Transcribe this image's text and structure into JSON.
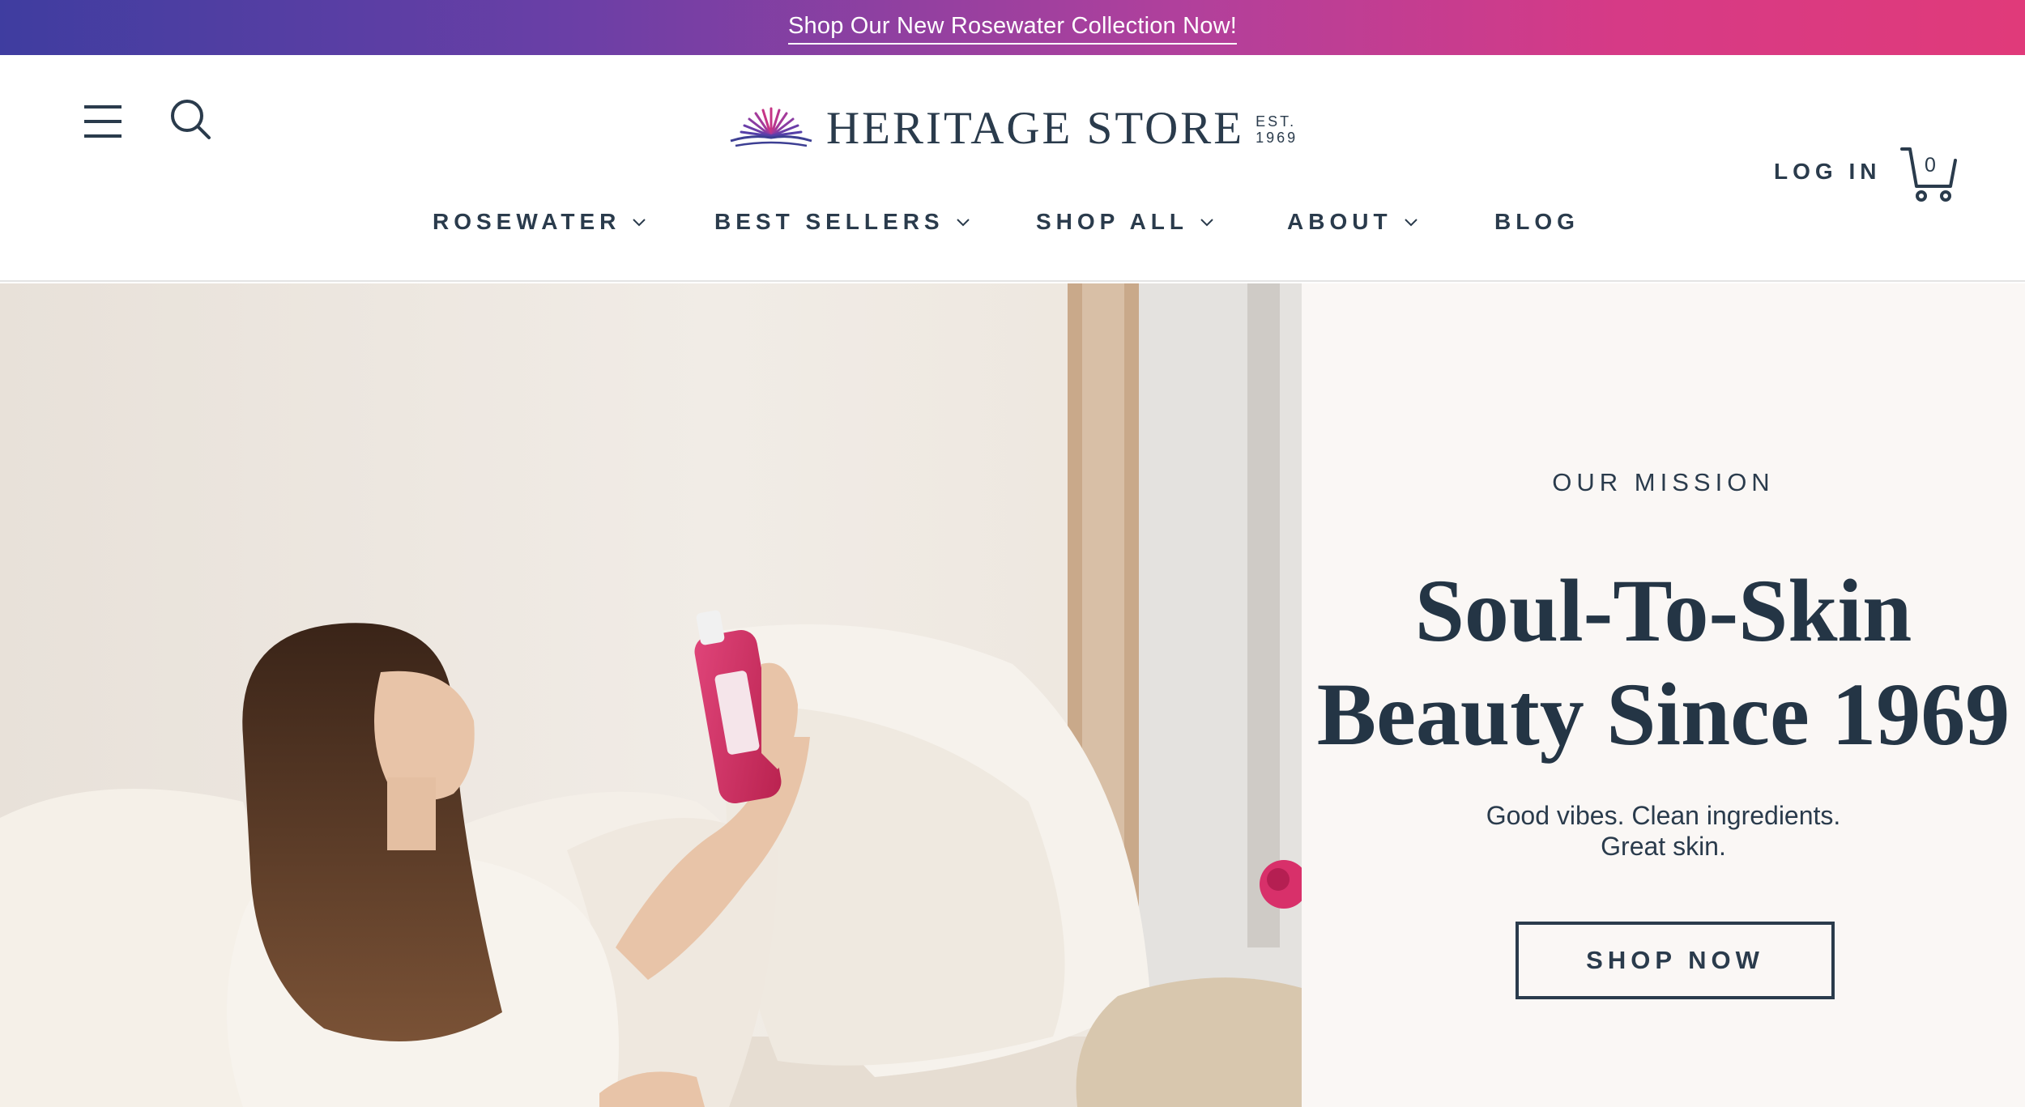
{
  "announcement": {
    "text": "Shop Our New Rosewater Collection Now!"
  },
  "header": {
    "logo": {
      "name": "HERITAGE STORE",
      "est_line1": "EST.",
      "est_line2": "1969"
    },
    "login_label": "LOG IN",
    "cart_count": "0",
    "icons": {
      "menu": "hamburger-menu-icon",
      "search": "search-icon",
      "cart": "cart-icon",
      "logo_mark": "sunburst-logo-icon"
    }
  },
  "nav": {
    "items": [
      {
        "label": "ROSEWATER",
        "has_dropdown": true
      },
      {
        "label": "BEST SELLERS",
        "has_dropdown": true
      },
      {
        "label": "SHOP ALL",
        "has_dropdown": true
      },
      {
        "label": "ABOUT",
        "has_dropdown": true
      },
      {
        "label": "BLOG",
        "has_dropdown": false
      }
    ]
  },
  "hero": {
    "eyebrow": "OUR MISSION",
    "headline_line1": "Soul-To-Skin",
    "headline_line2": "Beauty Since 1969",
    "sub_line1": "Good vibes. Clean ingredients.",
    "sub_line2": "Great skin.",
    "cta_label": "SHOP NOW"
  },
  "colors": {
    "brand_navy": "#2a3b4c",
    "announce_gradient_start": "#3f3da0",
    "announce_gradient_end": "#e03a7a",
    "mission_bg": "#faf7f5",
    "rose": "#d8306a"
  }
}
